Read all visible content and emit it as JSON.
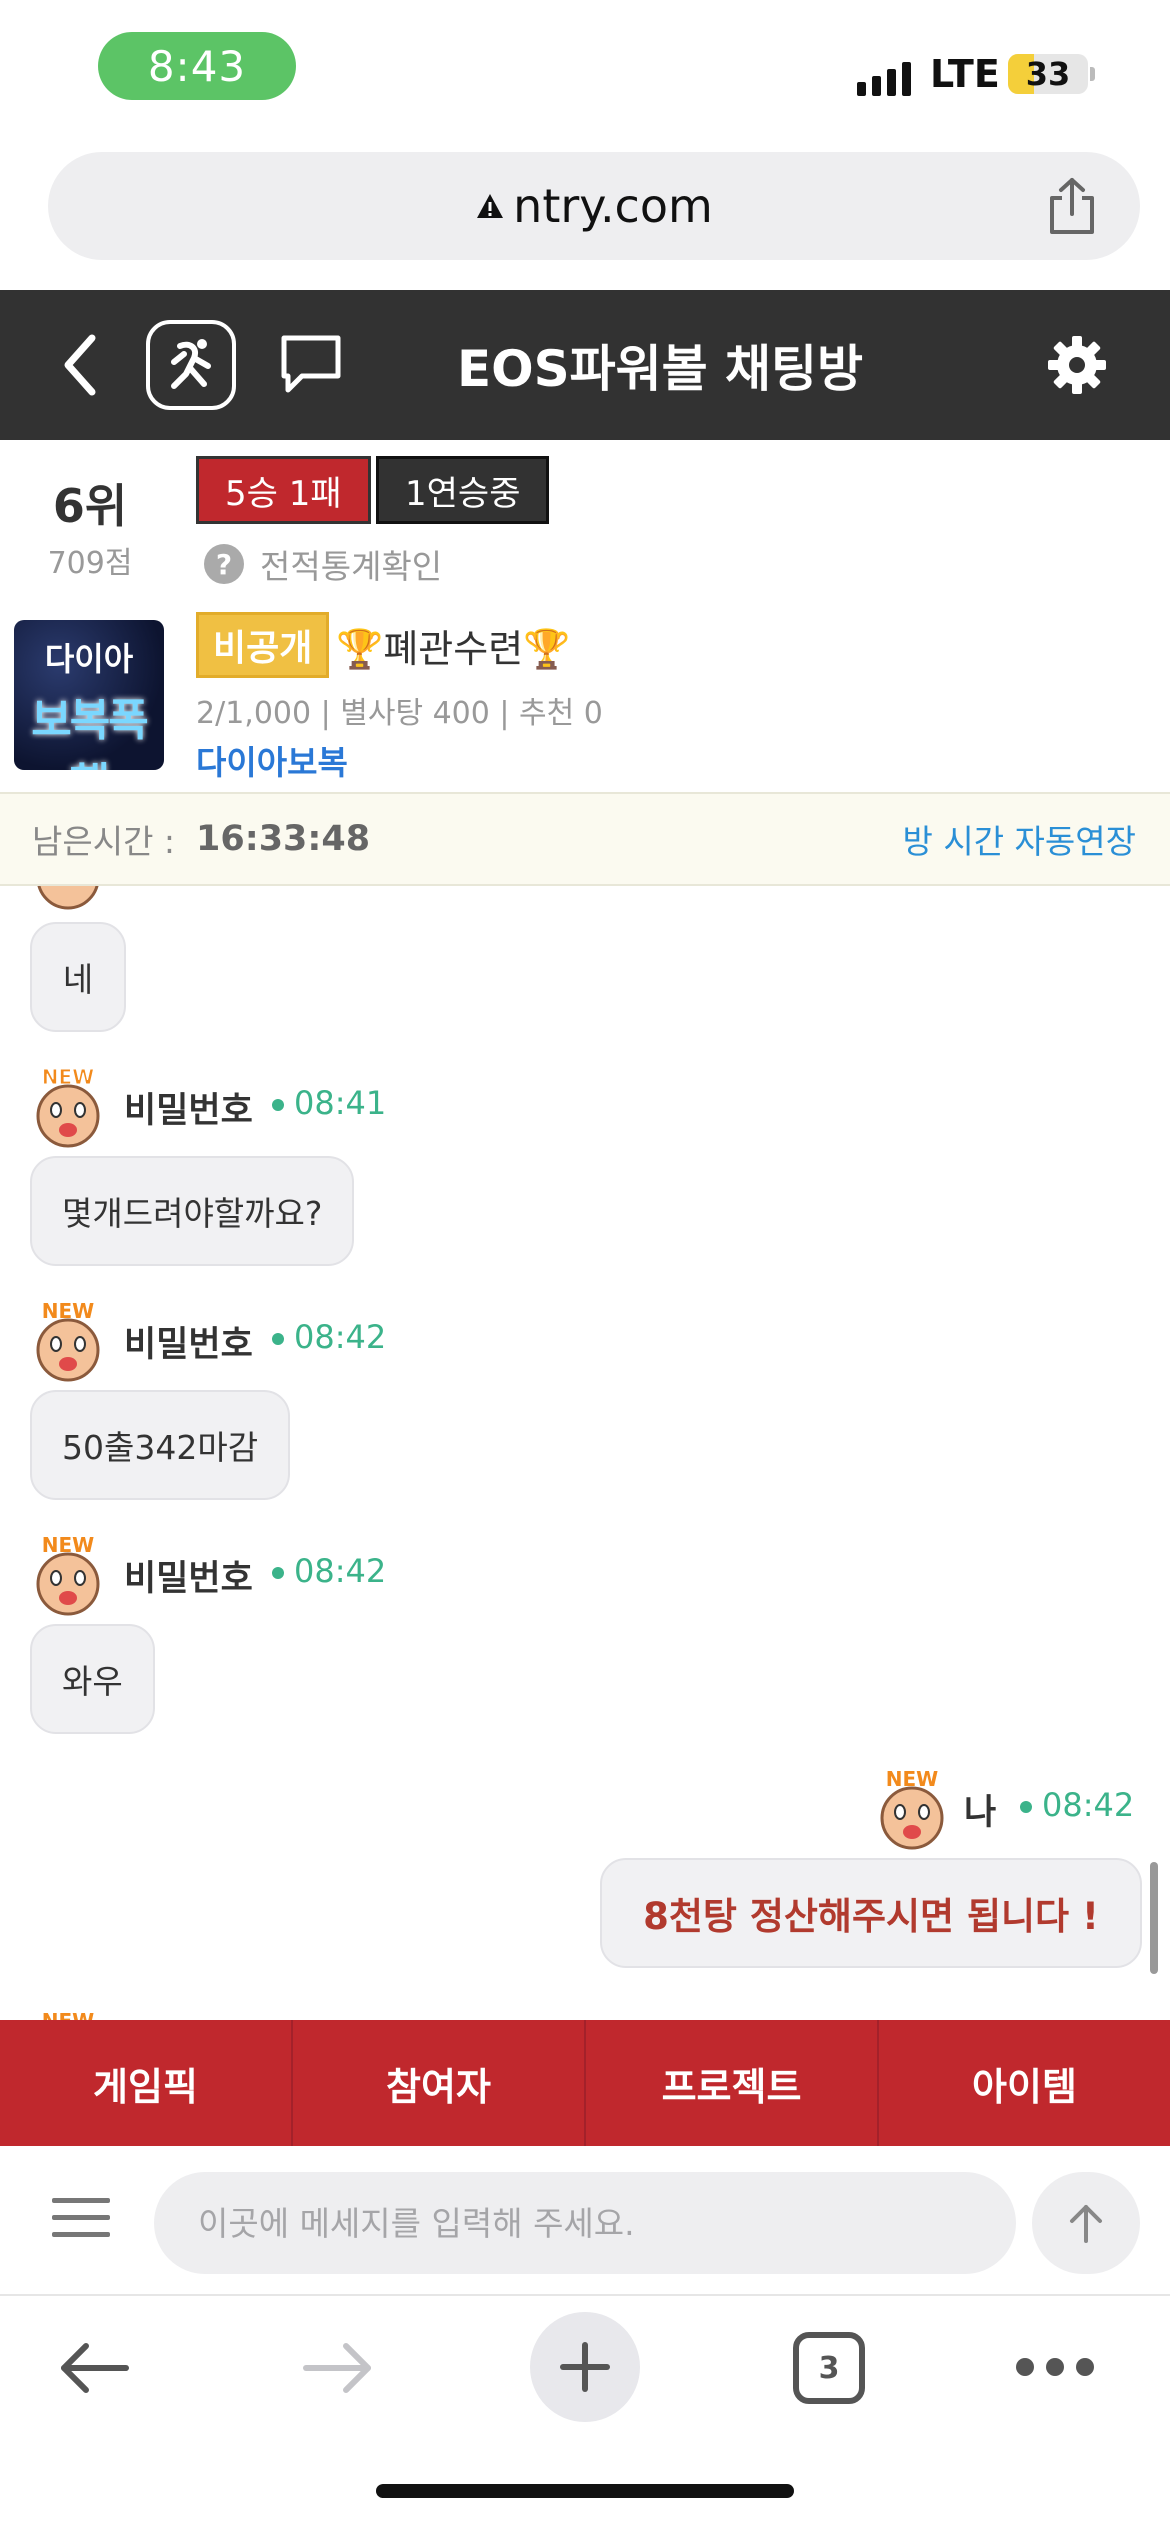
{
  "status_bar": {
    "time": "8:43",
    "network": "LTE",
    "battery": "33",
    "battery_level": 0.33
  },
  "browser": {
    "url": "ntry.com"
  },
  "header": {
    "title": "EOS파워볼 채팅방"
  },
  "room": {
    "rank": "6위",
    "score": "709점",
    "record": "5승 1패",
    "streak": "1연승중",
    "stats_link": "전적통계확인",
    "thumbnail_top": "다이아",
    "thumbnail_bottom": "보복폭행",
    "private_badge": "비공개",
    "name": "🏆폐관수련🏆",
    "meta": "2/1,000 | 별사탕 400 | 추천 0",
    "owner": "다이아보복"
  },
  "timer": {
    "label": "남은시간 :",
    "value": "16:33:48",
    "extend_link": "방 시간 자동연장"
  },
  "messages": [
    {
      "sender": "",
      "time": "",
      "text": "네",
      "mine": false
    },
    {
      "sender": "비밀번호",
      "time": "08:41",
      "text": "몇개드려야할까요?",
      "mine": false
    },
    {
      "sender": "비밀번호",
      "time": "08:42",
      "text": "50출342마감",
      "mine": false
    },
    {
      "sender": "비밀번호",
      "time": "08:42",
      "text": "와우",
      "mine": false
    },
    {
      "sender": "나",
      "time": "08:42",
      "text": "8천탕 정산해주시면 됩니다 !",
      "mine": true
    }
  ],
  "avatar_badge": "NEW",
  "tabs": [
    "게임픽",
    "참여자",
    "프로젝트",
    "아이템"
  ],
  "input": {
    "placeholder": "이곳에 메세지를 입력해 주세요."
  },
  "browser_toolbar": {
    "tab_count": "3"
  },
  "colors": {
    "accent_red": "#c0282d",
    "header_dark": "#323232",
    "time_green": "#3bb38a",
    "link_blue": "#2a78d6"
  }
}
